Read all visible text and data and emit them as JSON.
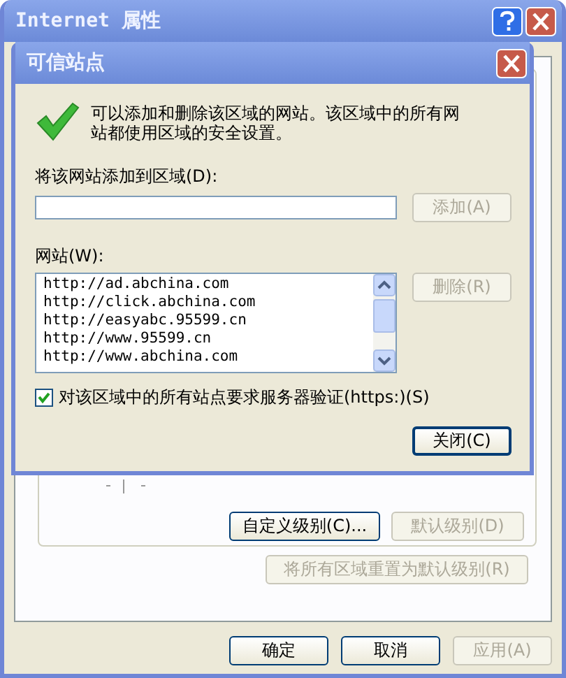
{
  "window": {
    "title": "Internet 属性"
  },
  "outer": {
    "custom_level_button": {
      "label": "自定义级别(C)...",
      "disabled": false
    },
    "default_level_button": {
      "label": "默认级别(D)",
      "disabled": true
    },
    "reset_all_button": {
      "label": "将所有区域重置为默认级别(R)",
      "disabled": true
    }
  },
  "footer_buttons": [
    {
      "label": "确定",
      "disabled": false
    },
    {
      "label": "取消",
      "disabled": false
    },
    {
      "label": "应用(A)",
      "disabled": true
    }
  ],
  "dialog": {
    "title": "可信站点",
    "message": "可以添加和删除该区域的网站。该区域中的所有网站都使用区域的安全设置。",
    "add_label": "将该网站添加到区域(D):",
    "add_button": {
      "label": "添加(A)",
      "disabled": true
    },
    "websites_label": "网站(W):",
    "remove_button": {
      "label": "删除(R)",
      "disabled": true
    },
    "websites": [
      {
        "url": "http://ad.abchina.com",
        "selected": false
      },
      {
        "url": "http://click.abchina.com",
        "selected": false
      },
      {
        "url": "http://easyabc.95599.cn",
        "selected": false
      },
      {
        "url": "http://www.95599.cn",
        "selected": false
      },
      {
        "url": "http://www.abchina.com",
        "selected": false
      }
    ],
    "https_checkbox": {
      "label": "对该区域中的所有站点要求服务器验证(https:)(S)",
      "checked": true
    },
    "close_button": {
      "label": "关闭(C)",
      "disabled": false
    }
  }
}
